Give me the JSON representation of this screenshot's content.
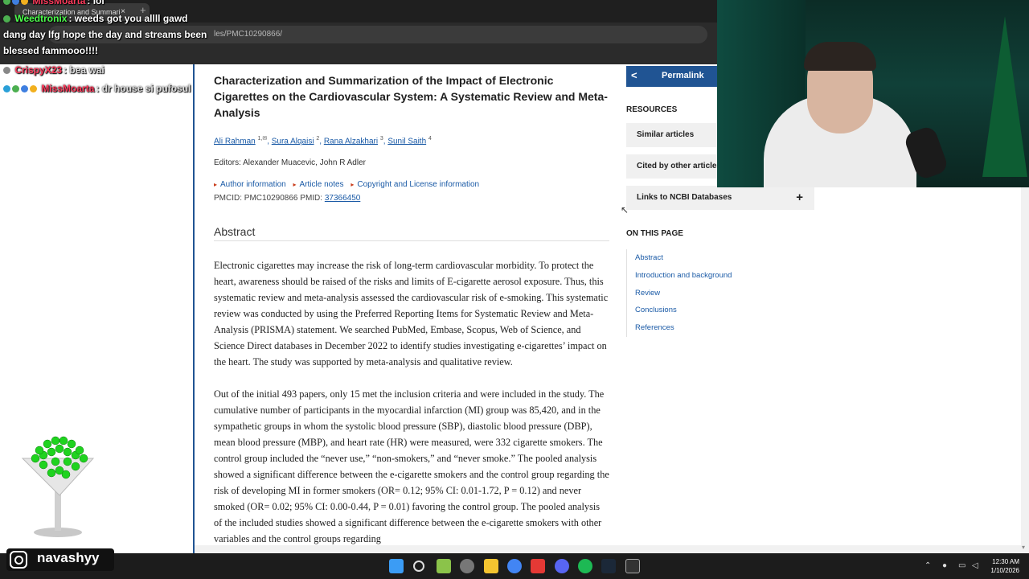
{
  "browser": {
    "tab_title": "Characterization and Summari",
    "tab_close": "×",
    "tab_new": "+",
    "address": "les/PMC10290866/"
  },
  "chat": [
    {
      "user": "MissMoarta",
      "message": ": lol"
    },
    {
      "user": "Weedtronix",
      "message": ": weeds got you allll gawd"
    },
    {
      "user": "",
      "message": "dang day lfg hope the day and streams been"
    },
    {
      "user": "",
      "message": "blessed fammooo!!!!"
    },
    {
      "user": "CrispyX23",
      "message": ": bea wai"
    },
    {
      "user": "MissMoarta",
      "message": ": dr house si pufosul"
    }
  ],
  "article": {
    "title": "Characterization and Summarization of the Impact of Electronic Cigarettes on the Cardiovascular System: A Systematic Review and Meta-Analysis",
    "authors": [
      {
        "name": "Ali Rahman",
        "sup": "1,✉"
      },
      {
        "name": "Sura Alqaisi",
        "sup": "2"
      },
      {
        "name": "Rana Alzakhari",
        "sup": "3"
      },
      {
        "name": "Sunil Saith",
        "sup": "4"
      }
    ],
    "editors": "Editors: Alexander Muacevic, John R Adler",
    "notes": [
      "Author information",
      "Article notes",
      "Copyright and License information"
    ],
    "pmcid": "PMCID: PMC10290866  PMID: ",
    "pmid_link": "37366450",
    "abstract_heading": "Abstract",
    "paragraph1": "Electronic cigarettes may increase the risk of long-term cardiovascular morbidity. To protect the heart, awareness should be raised of the risks and limits of E-cigarette aerosol exposure. Thus, this systematic review and meta-analysis assessed the cardiovascular risk of e-smoking. This systematic review was conducted by using the Preferred Reporting Items for Systematic Review and Meta-Analysis (PRISMA) statement. We searched PubMed, Embase, Scopus, Web of Science, and Science Direct databases in December 2022 to identify studies investigating e-cigarettes’ impact on the heart. The study was supported by meta-analysis and qualitative review.",
    "paragraph2": "Out of the initial 493 papers, only 15 met the inclusion criteria and were included in the study. The cumulative number of participants in the myocardial infarction (MI) group was 85,420, and in the sympathetic groups in whom the systolic blood pressure (SBP), diastolic blood pressure (DBP), mean blood pressure (MBP), and heart rate (HR) were measured, were 332 cigarette smokers. The control group included the “never use,” “non-smokers,” and “never smoke.” The pooled analysis showed a significant difference between the e-cigarette smokers and the control group regarding the risk of developing MI in former smokers (OR= 0.12; 95% CI: 0.01-1.72, P = 0.12) and never smoked (OR= 0.02; 95% CI: 0.00-0.44, P = 0.01) favoring the control group. The pooled analysis of the included studies showed a significant difference between the e-cigarette smokers with other variables and the control groups regarding"
  },
  "sidebar": {
    "permalink": "Permalink",
    "resources_heading": "RESOURCES",
    "resources": [
      "Similar articles",
      "Cited by other articles",
      "Links to NCBI Databases"
    ],
    "plus": "+",
    "on_this_page_heading": "ON THIS PAGE",
    "toc": [
      "Abstract",
      "Introduction and background",
      "Review",
      "Conclusions",
      "References"
    ]
  },
  "overlay": {
    "instagram": "navashyy"
  },
  "taskbar": {
    "time": "12:30 AM",
    "date": "1/10/2026"
  },
  "colors": {
    "accent": "#205493",
    "link": "#1a5aa6",
    "chat_user": "#ff3b5c",
    "chat_user_green": "#4cff4c"
  }
}
